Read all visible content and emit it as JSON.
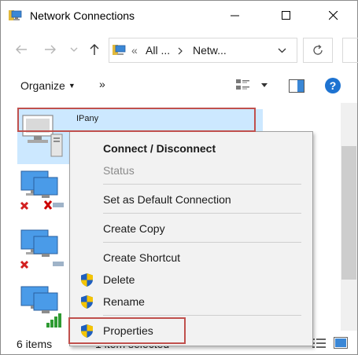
{
  "window": {
    "title": "Network Connections"
  },
  "address_bar": {
    "segment_1": "All ...",
    "segment_2": "Netw..."
  },
  "command_bar": {
    "organize_label": "Organize",
    "more_label": "»"
  },
  "content": {
    "selected_item_label": "IPany"
  },
  "context_menu": {
    "items": [
      {
        "label": "Connect / Disconnect",
        "bold": true
      },
      {
        "label": "Status",
        "disabled": true
      },
      {
        "label": "Set as Default Connection"
      },
      {
        "label": "Create Copy"
      },
      {
        "label": "Create Shortcut"
      },
      {
        "label": "Delete",
        "icon": "uac-shield-icon"
      },
      {
        "label": "Rename",
        "icon": "uac-shield-icon"
      },
      {
        "label": "Properties",
        "icon": "uac-shield-icon"
      }
    ]
  },
  "status_bar": {
    "item_count": "6 items",
    "selection": "1 item selected"
  },
  "colors": {
    "selection": "#cce8ff",
    "highlight_box": "#c0504d",
    "menu_bg": "#f2f2f2",
    "help_blue": "#1e73d1"
  }
}
